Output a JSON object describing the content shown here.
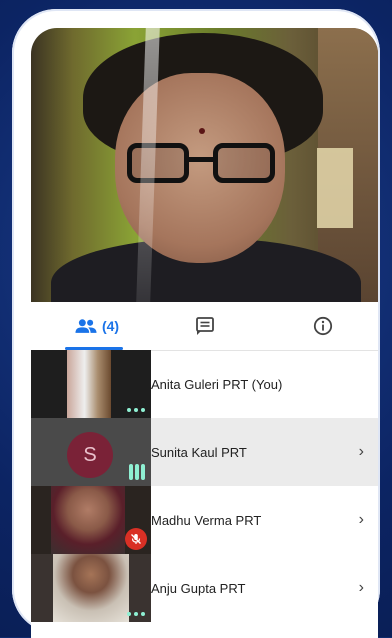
{
  "tabs": {
    "people_count": "(4)",
    "active": "people"
  },
  "icons": {
    "people": "people-icon",
    "chat": "chat-icon",
    "info": "info-icon",
    "chevron": "chevron-right-icon"
  },
  "colors": {
    "accent": "#1a73e8",
    "audio_indicator": "#8ff0d3",
    "mute_red": "#d93025",
    "avatar_bg": "#7a2237"
  },
  "participants": [
    {
      "name": "Anita Guleri PRT (You)",
      "tile": "video",
      "indicator": "dots"
    },
    {
      "name": "Sunita Kaul PRT",
      "tile": "avatar",
      "initial": "S",
      "indicator": "bars"
    },
    {
      "name": "Madhu Verma PRT",
      "tile": "video",
      "indicator": "muted"
    },
    {
      "name": "Anju Gupta PRT",
      "tile": "video",
      "indicator": "dots"
    }
  ],
  "chevron": "›"
}
